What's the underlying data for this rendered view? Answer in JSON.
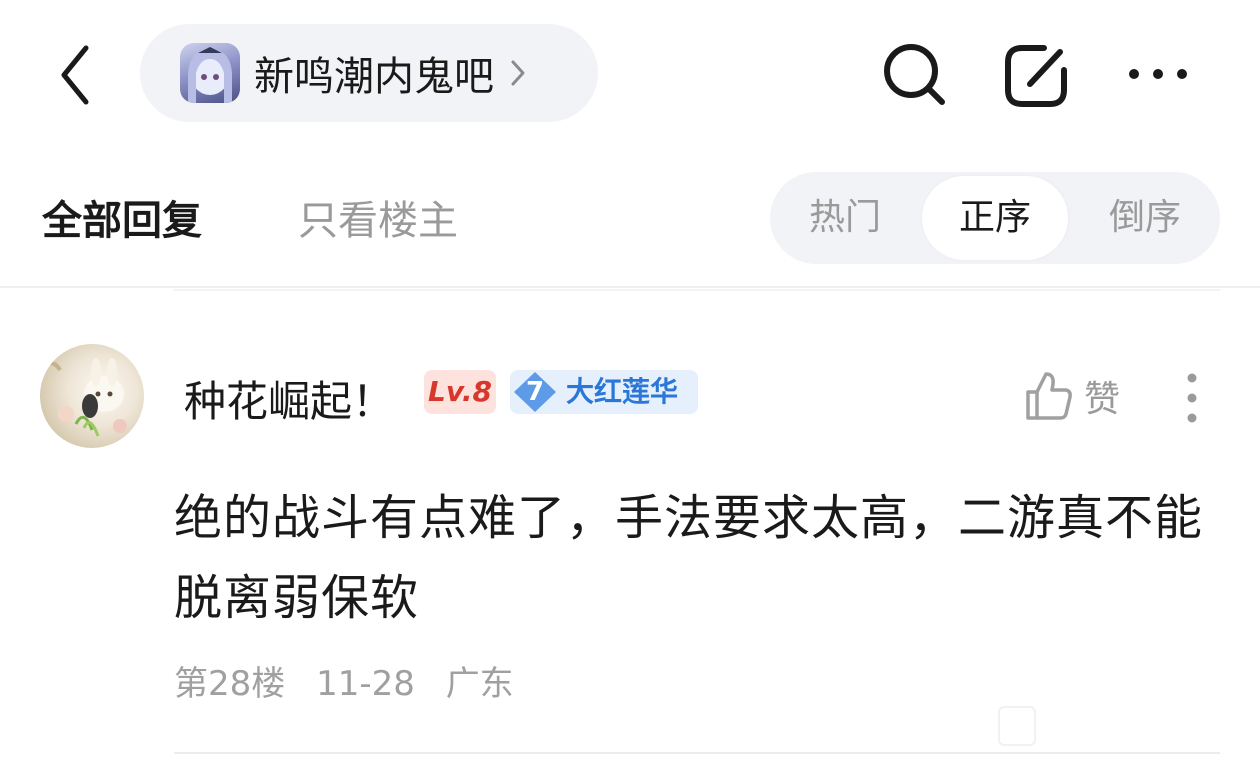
{
  "header": {
    "forum_name": "新鸣潮内鬼吧",
    "icons": [
      "back-arrow-icon",
      "forum-avatar",
      "chevron-right-icon",
      "search-icon",
      "share-icon",
      "more-horizontal-icon"
    ]
  },
  "tabs": {
    "all_replies": "全部回复",
    "only_op": "只看楼主",
    "active": "全部回复"
  },
  "sort": {
    "options": [
      "热门",
      "正序",
      "倒序"
    ],
    "selected": "正序"
  },
  "post": {
    "username": "种花崛起！",
    "level_badge": "Lv.8",
    "title_level": "7",
    "title_name": "大红莲华",
    "like_label": "赞",
    "content": "绝的战斗有点难了，手法要求太高，二游真不能脱离弱保软",
    "floor": "第28楼",
    "date": "11-28",
    "location": "广东"
  },
  "colors": {
    "pill_bg": "#f2f3f7",
    "level_badge_bg": "#fde2de",
    "level_badge_text": "#d8372b",
    "title_badge_bg": "#e6f0fd",
    "title_badge_text": "#2a77d8",
    "muted_text": "#9a9a9a"
  }
}
